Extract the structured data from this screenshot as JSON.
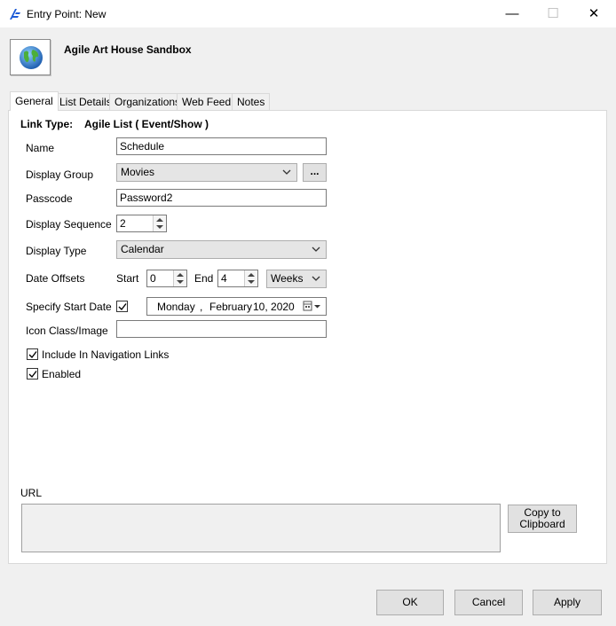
{
  "window": {
    "title": "Entry Point: New",
    "min_glyph": "—",
    "max_glyph": "☐",
    "close_glyph": "✕"
  },
  "header": {
    "site_name": "Agile Art House Sandbox",
    "icon": "globe-icon"
  },
  "tabs": [
    {
      "label": "General",
      "active": true
    },
    {
      "label": "List Details"
    },
    {
      "label": "Organizations"
    },
    {
      "label": "Web Feed"
    },
    {
      "label": "Notes"
    }
  ],
  "form": {
    "link_type_label": "Link Type:",
    "link_type_value": "Agile List ( Event/Show )",
    "name_label": "Name",
    "name_value": "Schedule",
    "display_group_label": "Display Group",
    "display_group_value": "Movies",
    "browse_label": "...",
    "passcode_label": "Passcode",
    "passcode_value": "Password2",
    "display_sequence_label": "Display Sequence",
    "display_sequence_value": "2",
    "display_type_label": "Display Type",
    "display_type_value": "Calendar",
    "date_offsets_label": "Date Offsets",
    "start_label": "Start",
    "start_value": "0",
    "end_label": "End",
    "end_value": "4",
    "offset_unit_value": "Weeks",
    "specify_start_date_label": "Specify Start Date",
    "specify_start_date_checked": true,
    "date_weekday": "Monday",
    "date_sep": ",",
    "date_month": "February",
    "date_day_year": "10, 2020",
    "icon_class_label": "Icon Class/Image",
    "icon_class_value": "",
    "include_nav_label": "Include In Navigation Links",
    "include_nav_checked": true,
    "enabled_label": "Enabled",
    "enabled_checked": true,
    "url_label": "URL",
    "url_value": "",
    "copy_line1": "Copy to",
    "copy_line2": "Clipboard"
  },
  "footer": {
    "ok_label": "OK",
    "cancel_label": "Cancel",
    "apply_label": "Apply"
  },
  "colors": {
    "accent": "#1e5bd6",
    "window_bg": "#f0f0f0",
    "panel_bg": "#ffffff"
  }
}
